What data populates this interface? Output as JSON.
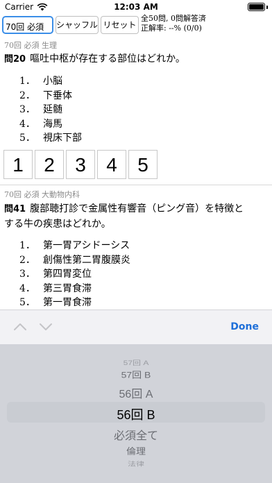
{
  "status_bar": {
    "carrier": "Carrier",
    "time": "12:03 AM"
  },
  "toolbar": {
    "selected_set": "70回 必須",
    "shuffle_label": "シャッフル",
    "reset_label": "リセット",
    "score_line1": "全50問, 0問解答済",
    "score_line2": "正解率: --% (0/0)"
  },
  "questions": [
    {
      "meta": "70回 必須 生理",
      "number": "問20",
      "text_line1": "嘔吐中枢が存在する部位はどれか。",
      "text_line2": "",
      "choices": [
        {
          "n": "1．",
          "t": "小脳"
        },
        {
          "n": "2．",
          "t": "下垂体"
        },
        {
          "n": "3．",
          "t": "延髄"
        },
        {
          "n": "4．",
          "t": "海馬"
        },
        {
          "n": "5．",
          "t": "視床下部"
        }
      ],
      "answers": [
        "1",
        "2",
        "3",
        "4",
        "5"
      ]
    },
    {
      "meta": "70回 必須 大動物内科",
      "number": "問41",
      "text_line1": "腹部聴打診で金属性有響音（ピング音）を特徴と",
      "text_line2": "する牛の疾患はどれか。",
      "choices": [
        {
          "n": "1．",
          "t": "第一胃アシドーシス"
        },
        {
          "n": "2．",
          "t": "創傷性第二胃腹膜炎"
        },
        {
          "n": "3．",
          "t": "第四胃変位"
        },
        {
          "n": "4．",
          "t": "第三胃食滞"
        },
        {
          "n": "5．",
          "t": "第一胃食滞"
        }
      ]
    }
  ],
  "accessory": {
    "done_label": "Done"
  },
  "picker": {
    "items": [
      "57回 A",
      "57回 B",
      "56回 A",
      "56回 B",
      "必須全て",
      "倫理",
      "法律"
    ],
    "selected_index": 3
  }
}
